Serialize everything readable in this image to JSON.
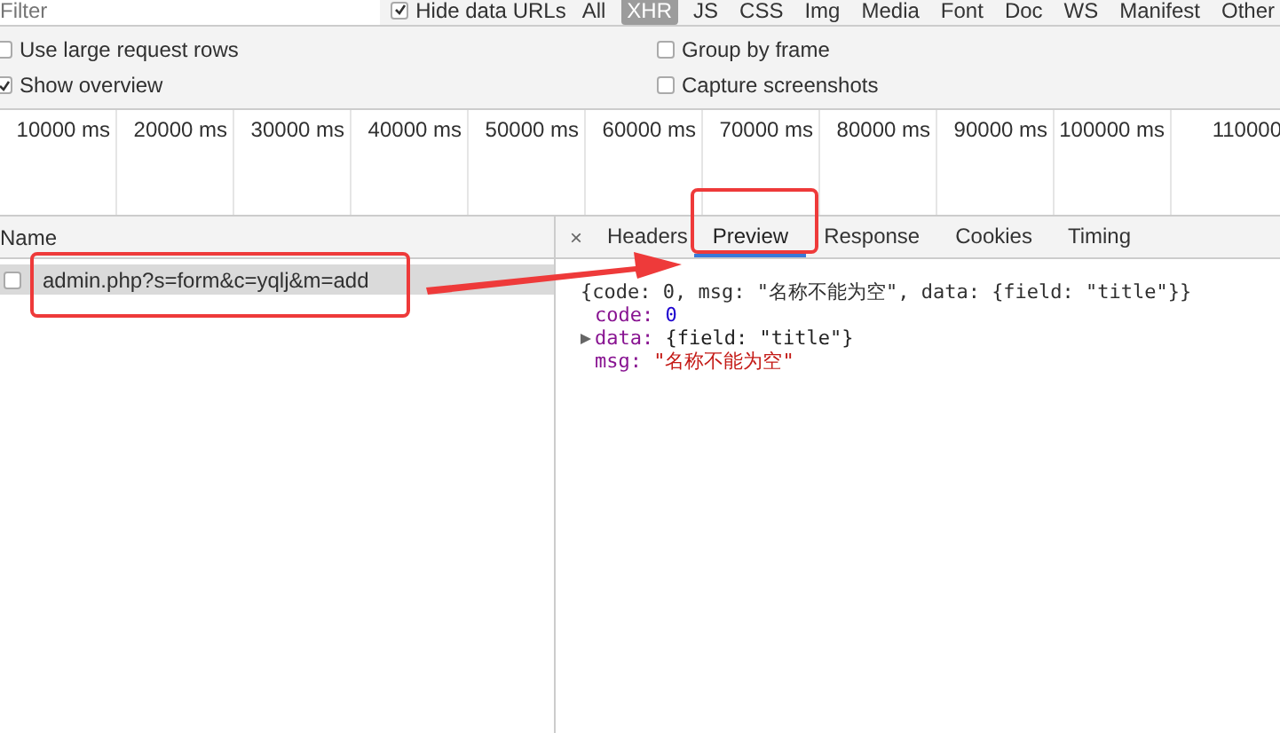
{
  "filter_bar": {
    "placeholder": "Filter",
    "hide_data_urls": {
      "label": "Hide data URLs",
      "checked": true
    },
    "types": [
      {
        "label": "All",
        "selected": false
      },
      {
        "label": "XHR",
        "selected": true
      },
      {
        "label": "JS",
        "selected": false
      },
      {
        "label": "CSS",
        "selected": false
      },
      {
        "label": "Img",
        "selected": false
      },
      {
        "label": "Media",
        "selected": false
      },
      {
        "label": "Font",
        "selected": false
      },
      {
        "label": "Doc",
        "selected": false
      },
      {
        "label": "WS",
        "selected": false
      },
      {
        "label": "Manifest",
        "selected": false
      },
      {
        "label": "Other",
        "selected": false
      }
    ]
  },
  "options": [
    {
      "label": "Use large request rows",
      "checked": false
    },
    {
      "label": "Group by frame",
      "checked": false
    },
    {
      "label": "Show overview",
      "checked": true
    },
    {
      "label": "Capture screenshots",
      "checked": false
    }
  ],
  "overview": {
    "ticks": [
      "10000 ms",
      "20000 ms",
      "30000 ms",
      "40000 ms",
      "50000 ms",
      "60000 ms",
      "70000 ms",
      "80000 ms",
      "90000 ms",
      "100000 ms",
      "110000"
    ]
  },
  "requests": {
    "column": "Name",
    "rows": [
      {
        "name": "admin.php?s=form&c=yqlj&m=add",
        "selected": true
      }
    ]
  },
  "detail": {
    "close": "×",
    "tabs": [
      {
        "label": "Headers",
        "selected": false
      },
      {
        "label": "Preview",
        "selected": true
      },
      {
        "label": "Response",
        "selected": false
      },
      {
        "label": "Cookies",
        "selected": false
      },
      {
        "label": "Timing",
        "selected": false
      }
    ],
    "summary": "{code: 0, msg: \"名称不能为空\", data: {field: \"title\"}}",
    "props": [
      {
        "key": "code:",
        "value": "0",
        "kind": "number",
        "expandable": false
      },
      {
        "key": "data:",
        "value": "{field: \"title\"}",
        "kind": "object",
        "expandable": true
      },
      {
        "key": "msg:",
        "value": "\"名称不能为空\"",
        "kind": "string",
        "expandable": false
      }
    ]
  }
}
